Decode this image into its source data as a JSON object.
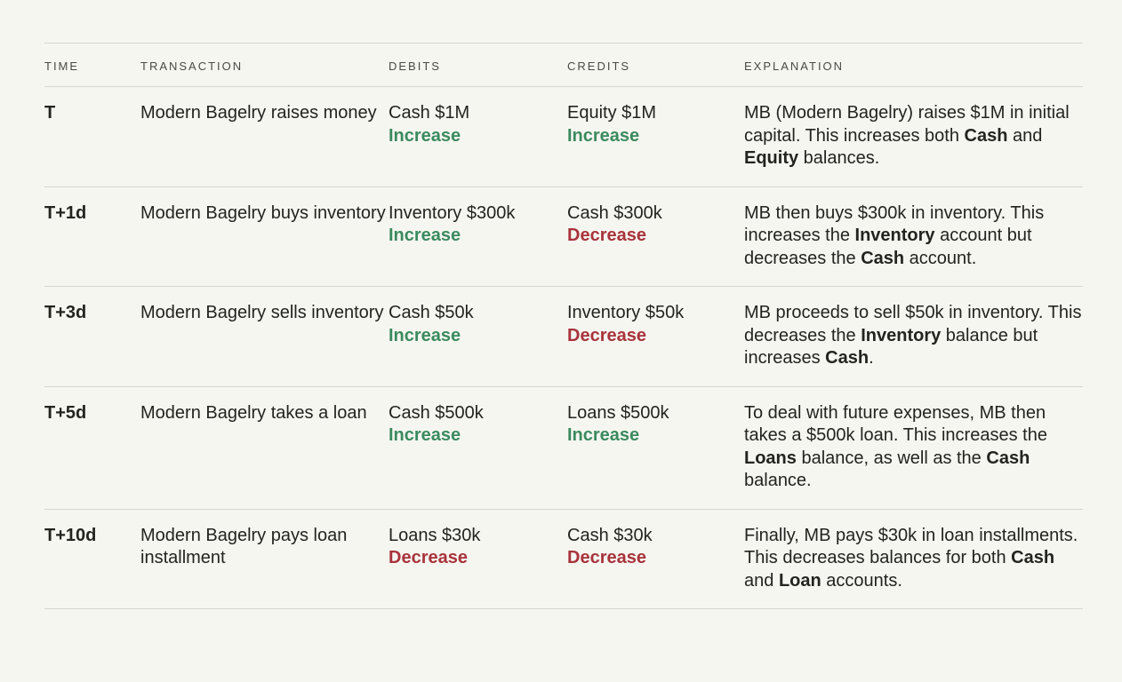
{
  "headers": {
    "time": "TIME",
    "transaction": "TRANSACTION",
    "debits": "DEBITS",
    "credits": "CREDITS",
    "explanation": "EXPLANATION"
  },
  "colors": {
    "increase": "#3b8a5e",
    "decrease": "#a8333b",
    "background": "#f6f6f1",
    "rule": "#d6d6cf"
  },
  "rows": [
    {
      "time": "T",
      "transaction": "Modern Bagelry raises money",
      "debit_amount": "Cash $1M",
      "debit_change": "Increase",
      "credit_amount": "Equity $1M",
      "credit_change": "Increase",
      "explanation": [
        {
          "text": "MB (Modern Bagelry) raises $1M in initial capital. This increases both "
        },
        {
          "text": "Cash",
          "bold": true
        },
        {
          "text": " and "
        },
        {
          "text": "Equity",
          "bold": true
        },
        {
          "text": " balances."
        }
      ]
    },
    {
      "time": "T+1d",
      "transaction": "Modern Bagelry buys inventory",
      "debit_amount": "Inventory $300k",
      "debit_change": "Increase",
      "credit_amount": "Cash $300k",
      "credit_change": "Decrease",
      "explanation": [
        {
          "text": "MB then buys $300k in inventory. This increases the "
        },
        {
          "text": "Inventory",
          "bold": true
        },
        {
          "text": " account but decreases the "
        },
        {
          "text": "Cash",
          "bold": true
        },
        {
          "text": " account."
        }
      ]
    },
    {
      "time": "T+3d",
      "transaction": "Modern Bagelry sells inventory",
      "debit_amount": "Cash $50k",
      "debit_change": "Increase",
      "credit_amount": "Inventory $50k",
      "credit_change": "Decrease",
      "explanation": [
        {
          "text": "MB proceeds to sell $50k in inventory. This decreases the "
        },
        {
          "text": "Inventory",
          "bold": true
        },
        {
          "text": " balance but increases "
        },
        {
          "text": "Cash",
          "bold": true
        },
        {
          "text": "."
        }
      ]
    },
    {
      "time": "T+5d",
      "transaction": "Modern Bagelry takes a loan",
      "debit_amount": "Cash $500k",
      "debit_change": "Increase",
      "credit_amount": "Loans $500k",
      "credit_change": "Increase",
      "explanation": [
        {
          "text": "To deal with future expenses, MB then takes a $500k loan. This increases the "
        },
        {
          "text": "Loans",
          "bold": true
        },
        {
          "text": " balance, as well as the "
        },
        {
          "text": "Cash",
          "bold": true
        },
        {
          "text": " balance."
        }
      ]
    },
    {
      "time": "T+10d",
      "transaction": "Modern Bagelry pays loan installment",
      "debit_amount": "Loans $30k",
      "debit_change": "Decrease",
      "credit_amount": "Cash $30k",
      "credit_change": "Decrease",
      "explanation": [
        {
          "text": "Finally, MB pays $30k in loan installments. This decreases balances for both "
        },
        {
          "text": "Cash",
          "bold": true
        },
        {
          "text": " and "
        },
        {
          "text": "Loan",
          "bold": true
        },
        {
          "text": " accounts."
        }
      ]
    }
  ]
}
